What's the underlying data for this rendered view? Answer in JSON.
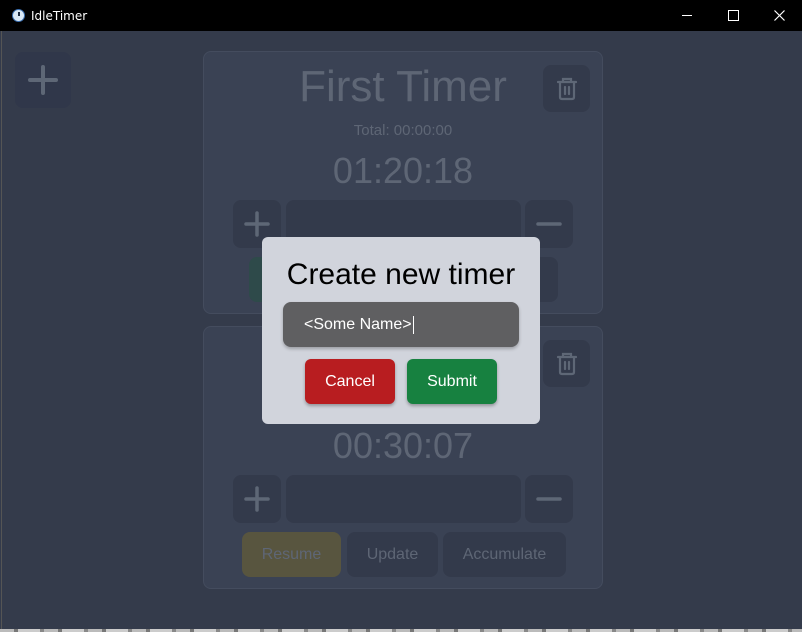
{
  "window": {
    "title": "IdleTimer",
    "icon": "stopwatch-icon",
    "controls": [
      "minimize",
      "maximize",
      "close"
    ]
  },
  "toolbar": {
    "add_timer_icon": "plus-icon"
  },
  "timers": [
    {
      "name": "First Timer",
      "total_label": "Total: 00:00:00",
      "elapsed": "01:20:18",
      "time_input_value": "",
      "delete_icon": "trash-icon",
      "buttons": [
        "",
        "",
        ""
      ]
    },
    {
      "name": "",
      "total_label": "",
      "elapsed": "00:30:07",
      "time_input_value": "",
      "delete_icon": "trash-icon",
      "buttons": [
        "Resume",
        "Update",
        "Accumulate"
      ]
    }
  ],
  "modal": {
    "title": "Create new timer",
    "input_value": "<Some Name>",
    "cancel_label": "Cancel",
    "submit_label": "Submit"
  },
  "colors": {
    "background": "#343b4b",
    "card": "#3a4254",
    "modal": "#d1d4dc",
    "cancel": "#b81d20",
    "submit": "#178140",
    "resume": "#58553f"
  }
}
